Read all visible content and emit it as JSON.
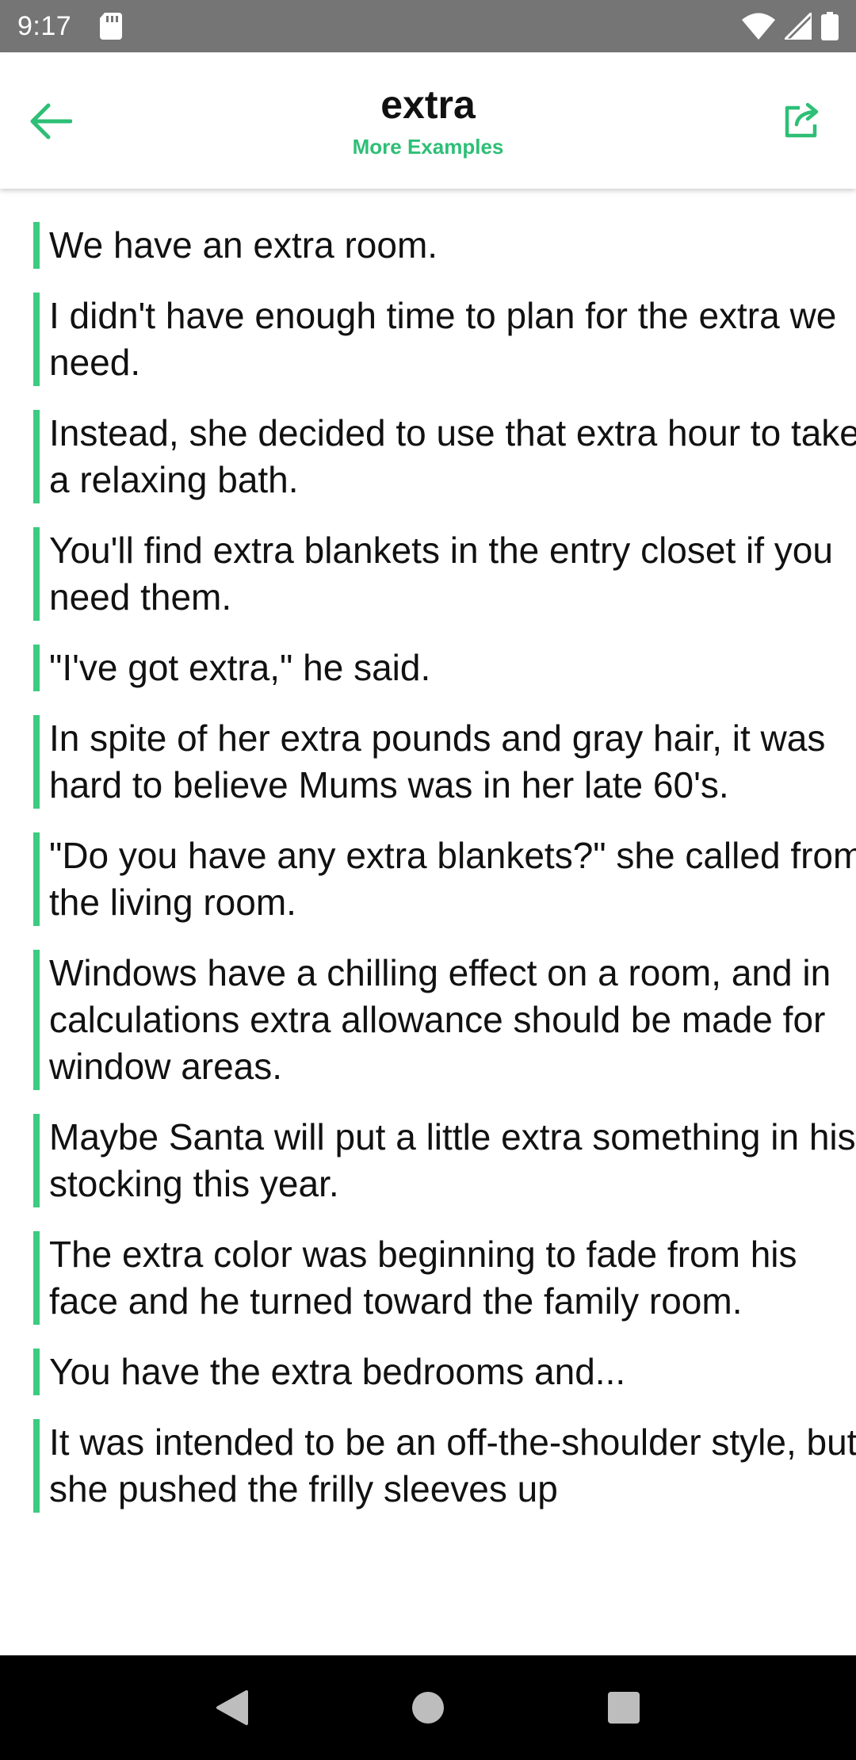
{
  "status_bar": {
    "time": "9:17",
    "icons": [
      "sd-card-icon",
      "wifi-icon",
      "signal-icon",
      "battery-icon"
    ]
  },
  "app_bar": {
    "title": "extra",
    "subtitle": "More Examples",
    "accent_color": "#2dbf76",
    "icons": [
      "back-arrow-icon",
      "share-icon"
    ]
  },
  "examples": [
    "We have an extra room.",
    "I didn't have enough time to plan for the extra we need.",
    "Instead, she decided to use that extra hour to take a relaxing bath.",
    "You'll find extra blankets in the entry closet if you need them.",
    "\"I've got extra,\" he said.",
    "In spite of her extra pounds and gray hair, it was hard to believe Mums was in her late 60's.",
    "\"Do you have any extra blankets?\" she called from the living room.",
    "Windows have a chilling effect on a room, and in calculations extra allowance should be made for window areas.",
    "Maybe Santa will put a little extra something in his stocking this year.",
    "The extra color was beginning to fade from his face and he turned toward the family room.",
    "You have the extra bedrooms and...",
    "It was intended to be an off-the-shoulder style, but she pushed the frilly sleeves up"
  ],
  "nav_bar": {
    "icons": [
      "back-triangle-icon",
      "home-circle-icon",
      "recents-square-icon"
    ]
  }
}
